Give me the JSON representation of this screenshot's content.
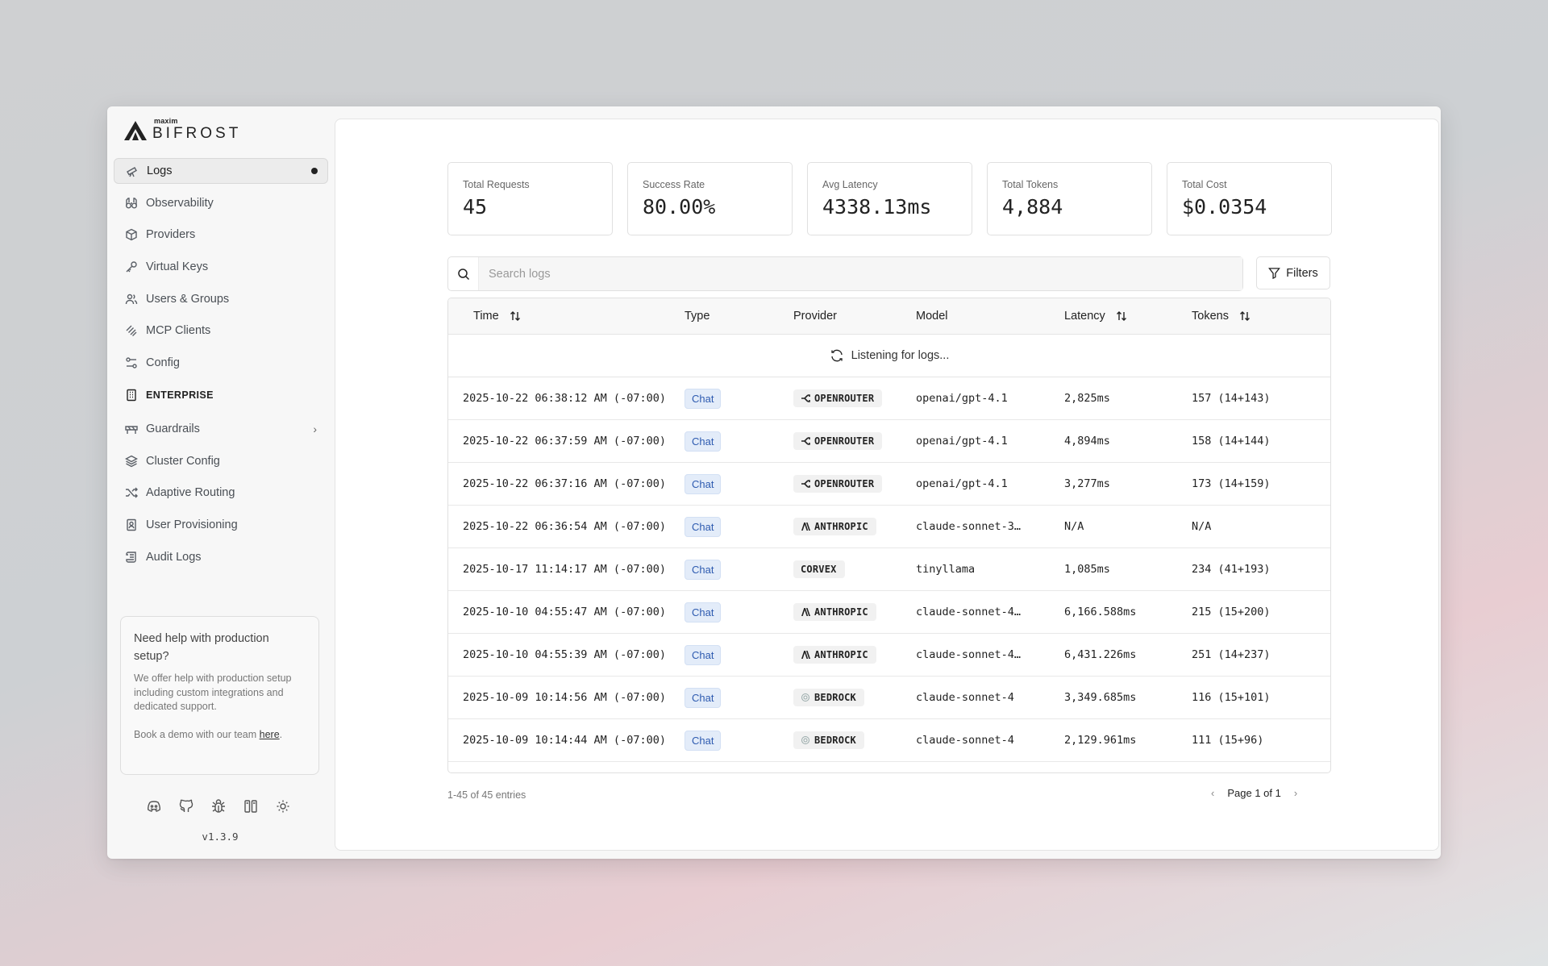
{
  "brand": {
    "sub": "maxim",
    "name": "BIFROST"
  },
  "sidebar": {
    "items": [
      {
        "label": "Logs",
        "icon": "telescope-icon",
        "active": true
      },
      {
        "label": "Observability",
        "icon": "binoculars-icon"
      },
      {
        "label": "Providers",
        "icon": "box-icon"
      },
      {
        "label": "Virtual Keys",
        "icon": "key-icon"
      },
      {
        "label": "Users & Groups",
        "icon": "users-icon"
      },
      {
        "label": "MCP Clients",
        "icon": "mcp-icon"
      },
      {
        "label": "Config",
        "icon": "settings-sliders-icon"
      }
    ],
    "enterprise_label": "ENTERPRISE",
    "enterprise_items": [
      {
        "label": "Guardrails",
        "icon": "guardrail-icon",
        "expandable": true
      },
      {
        "label": "Cluster Config",
        "icon": "layers-icon"
      },
      {
        "label": "Adaptive Routing",
        "icon": "shuffle-icon"
      },
      {
        "label": "User Provisioning",
        "icon": "id-badge-icon"
      },
      {
        "label": "Audit Logs",
        "icon": "scroll-icon"
      }
    ]
  },
  "help": {
    "title": "Need help with production setup?",
    "body": "We offer help with production setup including custom integrations and dedicated support.",
    "book_prefix": "Book a demo with our team ",
    "book_link": "here",
    "book_suffix": "."
  },
  "footer": {
    "icons": [
      "discord-icon",
      "github-icon",
      "bug-icon",
      "docs-icon",
      "theme-toggle-icon"
    ],
    "version": "v1.3.9"
  },
  "stats": [
    {
      "label": "Total Requests",
      "value": "45"
    },
    {
      "label": "Success Rate",
      "value": "80.00%"
    },
    {
      "label": "Avg Latency",
      "value": "4338.13ms"
    },
    {
      "label": "Total Tokens",
      "value": "4,884"
    },
    {
      "label": "Total Cost",
      "value": "$0.0354"
    }
  ],
  "search": {
    "placeholder": "Search logs",
    "value": ""
  },
  "filters_label": "Filters",
  "table": {
    "headers": {
      "time": "Time",
      "type": "Type",
      "provider": "Provider",
      "model": "Model",
      "latency": "Latency",
      "tokens": "Tokens"
    },
    "listening": "Listening for logs...",
    "rows": [
      {
        "time": "2025-10-22 06:38:12 AM (-07:00)",
        "type": "Chat",
        "provider": "OPENROUTER",
        "provider_icon": "openrouter-icon",
        "model": "openai/gpt-4.1",
        "latency": "2,825ms",
        "tokens": "157 (14+143)"
      },
      {
        "time": "2025-10-22 06:37:59 AM (-07:00)",
        "type": "Chat",
        "provider": "OPENROUTER",
        "provider_icon": "openrouter-icon",
        "model": "openai/gpt-4.1",
        "latency": "4,894ms",
        "tokens": "158 (14+144)"
      },
      {
        "time": "2025-10-22 06:37:16 AM (-07:00)",
        "type": "Chat",
        "provider": "OPENROUTER",
        "provider_icon": "openrouter-icon",
        "model": "openai/gpt-4.1",
        "latency": "3,277ms",
        "tokens": "173 (14+159)"
      },
      {
        "time": "2025-10-22 06:36:54 AM (-07:00)",
        "type": "Chat",
        "provider": "ANTHROPIC",
        "provider_icon": "anthropic-icon",
        "model": "claude-sonnet-3…",
        "latency": "N/A",
        "tokens": "N/A"
      },
      {
        "time": "2025-10-17 11:14:17 AM (-07:00)",
        "type": "Chat",
        "provider": "CORVEX",
        "provider_icon": "",
        "model": "tinyllama",
        "latency": "1,085ms",
        "tokens": "234 (41+193)"
      },
      {
        "time": "2025-10-10 04:55:47 AM (-07:00)",
        "type": "Chat",
        "provider": "ANTHROPIC",
        "provider_icon": "anthropic-icon",
        "model": "claude-sonnet-4…",
        "latency": "6,166.588ms",
        "tokens": "215 (15+200)"
      },
      {
        "time": "2025-10-10 04:55:39 AM (-07:00)",
        "type": "Chat",
        "provider": "ANTHROPIC",
        "provider_icon": "anthropic-icon",
        "model": "claude-sonnet-4…",
        "latency": "6,431.226ms",
        "tokens": "251 (14+237)"
      },
      {
        "time": "2025-10-09 10:14:56 AM (-07:00)",
        "type": "Chat",
        "provider": "BEDROCK",
        "provider_icon": "bedrock-icon",
        "model": "claude-sonnet-4",
        "latency": "3,349.685ms",
        "tokens": "116 (15+101)"
      },
      {
        "time": "2025-10-09 10:14:44 AM (-07:00)",
        "type": "Chat",
        "provider": "BEDROCK",
        "provider_icon": "bedrock-icon",
        "model": "claude-sonnet-4",
        "latency": "2,129.961ms",
        "tokens": "111 (15+96)"
      }
    ]
  },
  "pagination": {
    "entries": "1-45 of 45 entries",
    "page": "Page 1 of 1"
  }
}
